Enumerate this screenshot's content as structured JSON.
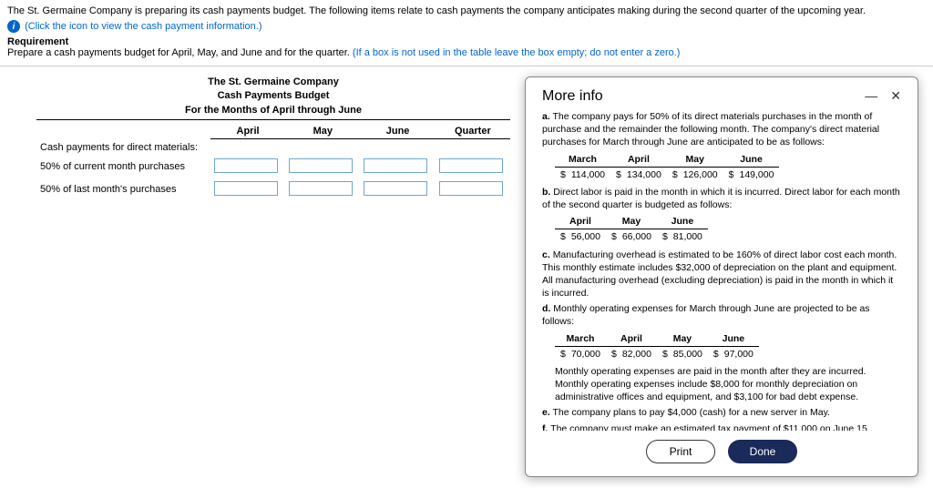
{
  "header": {
    "intro": "The St. Germaine Company is preparing its cash payments budget. The following items relate to cash payments the company anticipates making during the second quarter of the upcoming year.",
    "click_text": "(Click the icon to view the cash payment information.)",
    "req_label": "Requirement",
    "req_text": "Prepare a cash payments budget for April, May, and June and for the quarter. ",
    "req_hint": "(If a box is not used in the table leave the box empty; do not enter a zero.)"
  },
  "budget": {
    "company": "The St. Germaine Company",
    "title": "Cash Payments Budget",
    "period": "For the Months of April through June",
    "cols": {
      "c1": "April",
      "c2": "May",
      "c3": "June",
      "c4": "Quarter"
    },
    "rows": {
      "r1": "Cash payments for direct materials:",
      "r2": "50% of current month purchases",
      "r3": "50% of last month's purchases"
    }
  },
  "modal": {
    "title": "More info",
    "a": {
      "label": "a.",
      "text": "The company pays for 50% of its direct materials purchases in the month of purchase and the remainder the following month. The company's direct material purchases for March through June are anticipated to be as follows:",
      "cols": {
        "march": "March",
        "april": "April",
        "may": "May",
        "june": "June"
      },
      "vals": {
        "march": "114,000",
        "april": "134,000",
        "may": "126,000",
        "june": "149,000"
      }
    },
    "b": {
      "label": "b.",
      "text": "Direct labor is paid in the month in which it is incurred. Direct labor for each month of the second quarter is budgeted as follows:",
      "cols": {
        "april": "April",
        "may": "May",
        "june": "June"
      },
      "vals": {
        "april": "56,000",
        "may": "66,000",
        "june": "81,000"
      }
    },
    "c": {
      "label": "c.",
      "text": "Manufacturing overhead is estimated to be 160% of direct labor cost each month. This monthly estimate includes $32,000 of depreciation on the plant and equipment. All manufacturing overhead (excluding depreciation) is paid in the month in which it is incurred."
    },
    "d": {
      "label": "d.",
      "text": "Monthly operating expenses for March through June are projected to be as follows:",
      "cols": {
        "march": "March",
        "april": "April",
        "may": "May",
        "june": "June"
      },
      "vals": {
        "march": "70,000",
        "april": "82,000",
        "may": "85,000",
        "june": "97,000"
      },
      "note": "Monthly operating expenses are paid in the month after they are incurred. Monthly operating expenses include $8,000 for monthly depreciation on administrative offices and equipment, and $3,100 for bad debt expense."
    },
    "e": {
      "label": "e.",
      "text": "The company plans to pay $4,000 (cash) for a new server in May."
    },
    "f": {
      "label": "f.",
      "text": "The company must make an estimated tax payment of $11,000 on June 15."
    },
    "buttons": {
      "print": "Print",
      "done": "Done"
    },
    "currency": "$"
  }
}
